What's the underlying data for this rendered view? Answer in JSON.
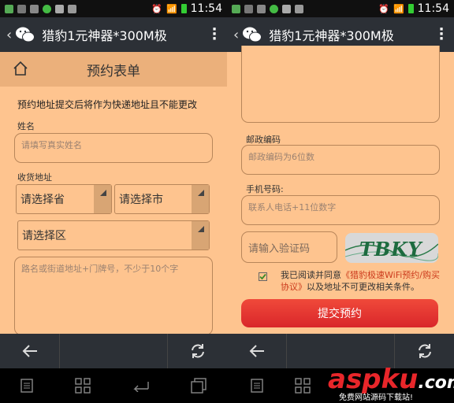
{
  "status": {
    "time": "11:54"
  },
  "appbar": {
    "title": "猎豹1元神器*300M极"
  },
  "form": {
    "title": "预约表单",
    "notice": "预约地址提交后将作为快递地址且不能更改",
    "name_label": "姓名",
    "name_placeholder": "请填写真实姓名",
    "address_label": "收货地址",
    "province": "请选择省",
    "city": "请选择市",
    "district": "请选择区",
    "street_placeholder": "路名或街道地址+门牌号，不少于10个字",
    "postcode_label": "邮政编码",
    "postcode_placeholder": "邮政编码为6位数",
    "phone_label": "手机号码:",
    "phone_placeholder": "联系人电话+11位数字",
    "captcha_placeholder": "请输入验证码",
    "captcha_text": "TBKY",
    "agree_prefix": "我已阅读并同意",
    "agree_link": "《猎豹极速WiFi预约/购买协议》",
    "agree_suffix": "以及地址不可更改相关条件。",
    "submit": "提交预约"
  },
  "watermark": {
    "main": "aspku",
    "suffix": ".com",
    "sub": "免费网站源码下载站!"
  },
  "colors": {
    "bg": "#fec48f",
    "header": "#ebb07b",
    "dark": "#2c3036",
    "accent": "#d9262a",
    "link": "#cc3b1d"
  }
}
